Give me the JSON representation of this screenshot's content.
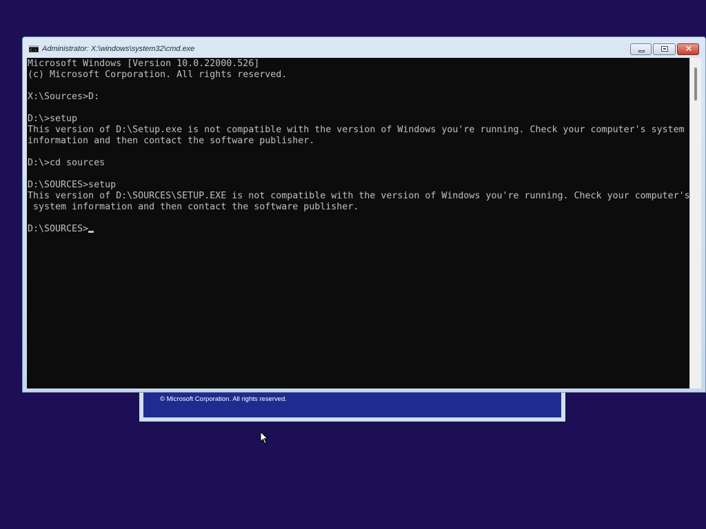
{
  "setup_dialog": {
    "copyright": "© Microsoft Corporation. All rights reserved."
  },
  "cmd_window": {
    "title": "Administrator: X:\\windows\\system32\\cmd.exe",
    "icon": "cmd-icon",
    "buttons": {
      "minimize": "minimize-icon",
      "maximize": "maximize-icon",
      "close": "close-icon"
    }
  },
  "console": {
    "lines": [
      "Microsoft Windows [Version 10.0.22000.526]",
      "(c) Microsoft Corporation. All rights reserved.",
      "",
      "X:\\Sources>D:",
      "",
      "D:\\>setup",
      "This version of D:\\Setup.exe is not compatible with the version of Windows you're running. Check your computer's system",
      "information and then contact the software publisher.",
      "",
      "D:\\>cd sources",
      "",
      "D:\\SOURCES>setup",
      "This version of D:\\SOURCES\\SETUP.EXE is not compatible with the version of Windows you're running. Check your computer's",
      " system information and then contact the software publisher.",
      ""
    ],
    "prompt": "D:\\SOURCES>"
  },
  "colors": {
    "desktop_bg": "#1c0f55",
    "console_bg": "#0c0c0c",
    "console_fg": "#c0c0c0"
  }
}
